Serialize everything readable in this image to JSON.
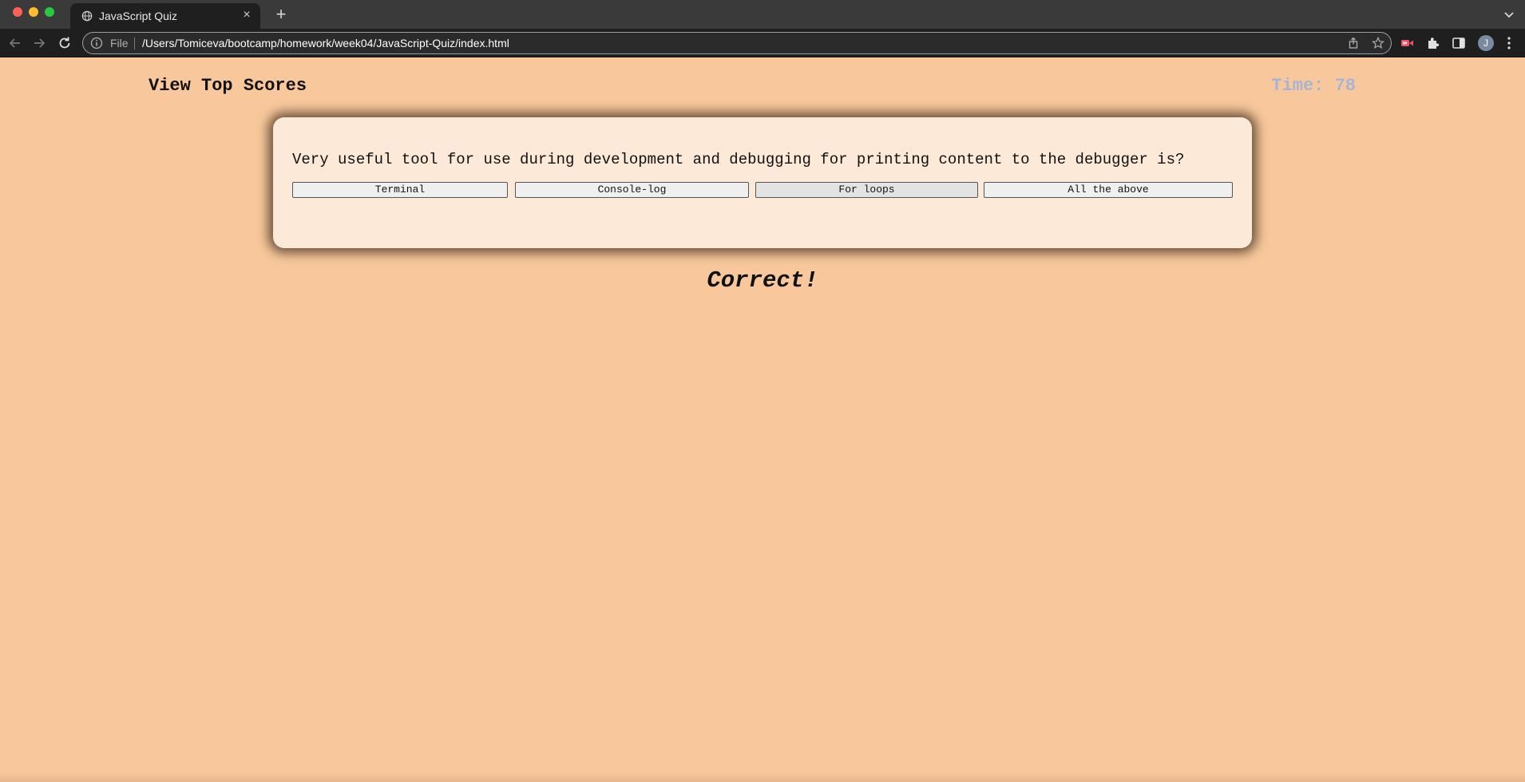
{
  "browser": {
    "tab_title": "JavaScript Quiz",
    "new_tab_symbol": "+",
    "close_symbol": "×",
    "scheme_label": "File",
    "url": "/Users/Tomiceva/bootcamp/homework/week04/JavaScript-Quiz/index.html",
    "profile_initial": "J"
  },
  "header": {
    "view_scores_label": "View Top Scores",
    "timer_label": "Time:",
    "timer_value": "78"
  },
  "quiz": {
    "question": "Very useful tool for use during development and debugging for printing content to the debugger is?",
    "answers": [
      "Terminal",
      "Console-log",
      "For loops",
      "All the above"
    ]
  },
  "feedback": {
    "result": "Correct!"
  },
  "colors": {
    "page_background": "#f8c89c",
    "card_background": "#fde9d8",
    "timer_color": "#a7b4d4"
  }
}
